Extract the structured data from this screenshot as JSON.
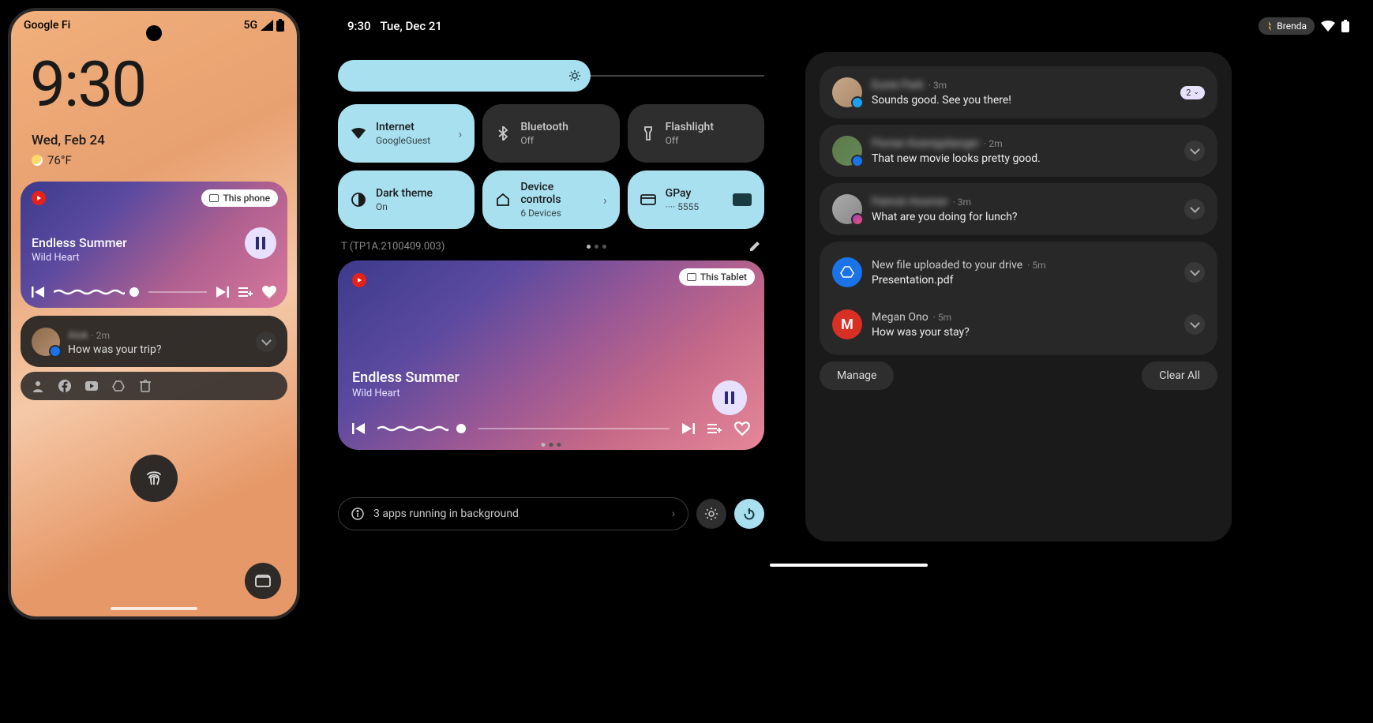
{
  "phone": {
    "carrier": "Google Fi",
    "network": "5G",
    "time": "9:30",
    "date": "Wed, Feb 24",
    "temp": "76°F",
    "media": {
      "cast_label": "This phone",
      "title": "Endless Summer",
      "artist": "Wild Heart"
    },
    "notification": {
      "sender": "Alok",
      "time": "2m",
      "message": "How was your trip?"
    }
  },
  "tablet": {
    "time": "9:30",
    "date": "Tue, Dec 21",
    "user": "Brenda",
    "build": "T (TP1A.2100409.003)",
    "tiles": [
      {
        "title": "Internet",
        "sub": "GoogleGuest",
        "on": true,
        "chev": true
      },
      {
        "title": "Bluetooth",
        "sub": "Off",
        "on": false
      },
      {
        "title": "Flashlight",
        "sub": "Off",
        "on": false
      },
      {
        "title": "Dark theme",
        "sub": "On",
        "on": true
      },
      {
        "title": "Device controls",
        "sub": "6 Devices",
        "on": true,
        "chev": true
      },
      {
        "title": "GPay",
        "sub": "···· 5555",
        "on": true,
        "card": true
      }
    ],
    "media": {
      "cast_label": "This Tablet",
      "title": "Endless Summer",
      "artist": "Wild Heart"
    },
    "bg_apps": "3 apps running in background",
    "notifications": [
      {
        "sender": "Eunie Park",
        "time": "3m",
        "msg": "Sounds good. See you there!",
        "count": "2",
        "blur": true,
        "badge": "twitter"
      },
      {
        "sender": "Florian Koenigsberger",
        "time": "2m",
        "msg": "That new movie looks pretty good.",
        "blur": true,
        "badge": "messages"
      },
      {
        "sender": "Patrick Hosmer",
        "time": "3m",
        "msg": "What are you doing for lunch?",
        "blur": true,
        "badge": "messenger"
      },
      {
        "app": "drive",
        "title": "New file uploaded to your drive",
        "time": "5m",
        "msg": "Presentation.pdf"
      },
      {
        "app": "gmail",
        "title": "Megan Ono",
        "time": "5m",
        "msg": "How was your stay?"
      }
    ],
    "actions": {
      "manage": "Manage",
      "clear": "Clear All"
    }
  }
}
